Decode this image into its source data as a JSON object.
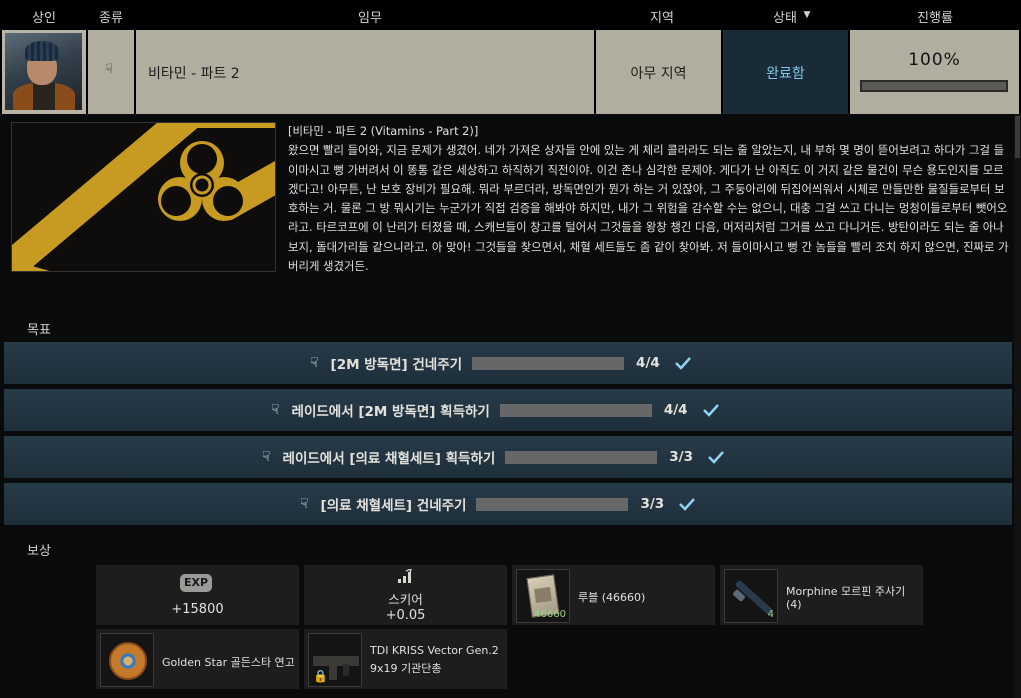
{
  "header": {
    "trader": "상인",
    "type": "종류",
    "task": "임무",
    "location": "지역",
    "status": "상태",
    "progress": "진행률"
  },
  "quest": {
    "name": "비타민 - 파트 2",
    "location": "아무 지역",
    "status": "완료함",
    "progress_text": "100%",
    "progress_fraction": 1.0
  },
  "description": {
    "title": "[비타민 - 파트 2 (Vitamins - Part 2)]",
    "body": "왔으면 빨리 들어와, 지금 문제가 생겼어. 네가 가져온 상자들 안에 있는 게 체리 콜라라도 되는 줄 알았는지, 내 부하 몇 명이 뜯어보려고 하다가 그걸 들이마시고 뻥 가버려서 이 똥통 같은 세상하고 하직하기 직전이야. 이건 존나 심각한 문제야. 게다가 난 아직도 이 거지 같은 물건이 무슨 용도인지를 모르겠다고! 아무튼, 난 보호 장비가 필요해. 뭐라 부르더라, 방독면인가 뭔가 하는 거 있잖아, 그 주둥아리에 뒤집어씌워서 시체로 만들만한 물질들로부터 보호하는 거. 물론 그 방 뭐시기는 누군가가 직접 검증을 해봐야 하지만, 내가 그 위험을 감수할 수는 없으니, 대충 그걸 쓰고 다니는 멍청이들로부터 뺏어오라고. 타르코프에 이 난리가 터졌을 때, 스캐브들이 창고를 털어서 그것들을 왕창 챙긴 다음, 머저리처럼 그거를 쓰고 다니거든. 방탄이라도 되는 줄 아나 보지, 돌대가리들 같으니라고. 아 맞아! 그것들을 찾으면서, 채혈 세트들도 좀 같이 찾아봐. 저 들이마시고 뻥 간 놈들을 빨리 조치 하지 않으면, 진짜로 가버리게 생겼거든."
  },
  "objectives_label": "목표",
  "objectives": [
    {
      "text": "[2M 방독면] 건네주기",
      "count": "4/4",
      "fraction": 1.0
    },
    {
      "text": "레이드에서 [2M 방독면] 획득하기",
      "count": "4/4",
      "fraction": 1.0
    },
    {
      "text": "레이드에서 [의료 채혈세트] 획득하기",
      "count": "3/3",
      "fraction": 1.0
    },
    {
      "text": "[의료 채혈세트] 건네주기",
      "count": "3/3",
      "fraction": 1.0
    }
  ],
  "rewards_label": "보상",
  "rewards": {
    "exp_icon": "EXP",
    "exp_value": "+15800",
    "skier_label": "스키어",
    "skier_value": "+0.05",
    "rouble_label": "루블  (46660)",
    "rouble_count": "46660",
    "morphine_label": "Morphine 모르핀 주사기",
    "morphine_qty": "(4)",
    "morphine_count": "4",
    "goldenstar_label": "Golden Star 골든스타 연고",
    "kriss_label_1": "TDI KRISS Vector Gen.2",
    "kriss_label_2": "9x19 기관단총"
  },
  "colors": {
    "row_bg": "#b1ad9f",
    "status_bg": "#1a2b38",
    "status_text": "#7fc8e8",
    "objective_bg": "#1e2f3b",
    "check": "#8fd3f0"
  }
}
